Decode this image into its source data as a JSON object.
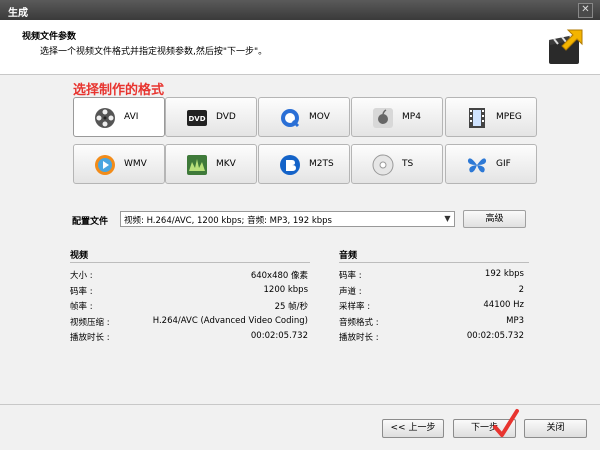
{
  "window": {
    "title": "生成",
    "close_glyph": "✕"
  },
  "header": {
    "title": "视频文件参数",
    "subtitle": "选择一个视频文件格式并指定视频参数,然后按\"下一步\"。"
  },
  "format_section": {
    "label": "选择制作的格式",
    "selected": "AVI",
    "formats": [
      {
        "label": "AVI",
        "icon": "film-reel-icon"
      },
      {
        "label": "DVD",
        "icon": "dvd-icon"
      },
      {
        "label": "MOV",
        "icon": "quicktime-icon"
      },
      {
        "label": "MP4",
        "icon": "apple-icon"
      },
      {
        "label": "MPEG",
        "icon": "film-strip-icon"
      },
      {
        "label": "WMV",
        "icon": "wmv-play-icon"
      },
      {
        "label": "MKV",
        "icon": "mkv-icon"
      },
      {
        "label": "M2TS",
        "icon": "bluray-icon"
      },
      {
        "label": "TS",
        "icon": "disc-icon"
      },
      {
        "label": "GIF",
        "icon": "butterfly-icon"
      }
    ]
  },
  "profile": {
    "label": "配置文件",
    "value": "视频: H.264/AVC, 1200 kbps; 音频: MP3, 192 kbps",
    "advanced_button": "高级"
  },
  "video_info": {
    "title": "视频",
    "rows": [
      {
        "key": "大小 :",
        "value": "640x480 像素"
      },
      {
        "key": "码率 :",
        "value": "1200 kbps"
      },
      {
        "key": "帧率 :",
        "value": "25 帧/秒"
      },
      {
        "key": "视频压缩 :",
        "value": "H.264/AVC (Advanced Video Coding)"
      },
      {
        "key": "播放时长 :",
        "value": "00:02:05.732"
      }
    ]
  },
  "audio_info": {
    "title": "音频",
    "rows": [
      {
        "key": "码率 :",
        "value": "192 kbps"
      },
      {
        "key": "声道 :",
        "value": "2"
      },
      {
        "key": "采样率 :",
        "value": "44100 Hz"
      },
      {
        "key": "音频格式 :",
        "value": "MP3"
      },
      {
        "key": "播放时长 :",
        "value": "00:02:05.732"
      }
    ]
  },
  "footer": {
    "back_label": "<< 上一步",
    "next_label": "下一步",
    "close_label": "关闭"
  },
  "colors": {
    "accent_red": "#e8342f",
    "title_bar": "#444444"
  }
}
